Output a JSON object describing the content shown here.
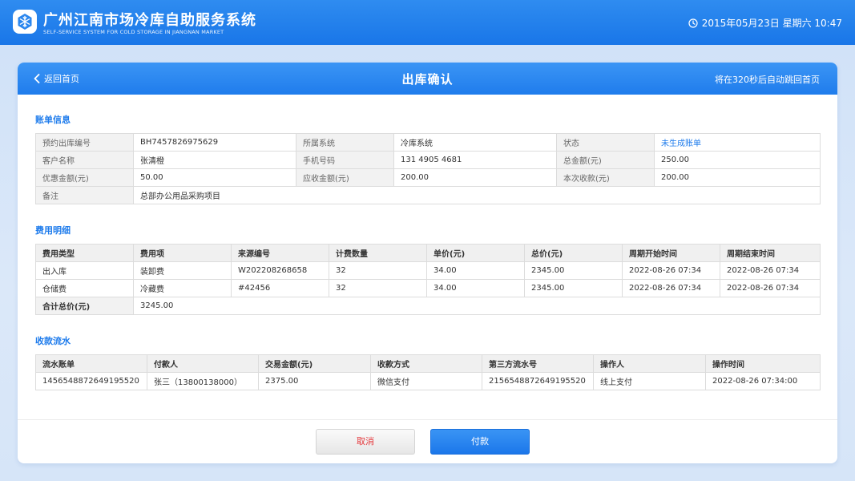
{
  "header": {
    "title": "广州江南市场冷库自助服务系统",
    "subtitle": "SELF-SERVICE SYSTEM FOR COLD STORAGE IN JIANGNAN MARKET",
    "datetime": "2015年05月23日  星期六  10:47"
  },
  "page": {
    "back_label": "返回首页",
    "title": "出库确认",
    "countdown": "将在320秒后自动跳回首页"
  },
  "bill": {
    "section_title": "账单信息",
    "rows": [
      [
        "预约出库编号",
        "BH7457826975629",
        "所属系统",
        "冷库系统",
        "状态",
        "未生成账单"
      ],
      [
        "客户名称",
        "张清橙",
        "手机号码",
        "131 4905 4681",
        "总金额(元)",
        "250.00"
      ],
      [
        "优惠金额(元)",
        "50.00",
        "应收金额(元)",
        "200.00",
        "本次收款(元)",
        "200.00"
      ],
      [
        "备注",
        "总部办公用品采购项目"
      ]
    ],
    "status_color": "#1f7cec"
  },
  "fees": {
    "section_title": "费用明细",
    "headers": [
      "费用类型",
      "费用项",
      "来源编号",
      "计费数量",
      "单价(元)",
      "总价(元)",
      "周期开始时间",
      "周期结束时间"
    ],
    "rows": [
      [
        "出入库",
        "装卸费",
        "W202208268658",
        "32",
        "34.00",
        "2345.00",
        "2022-08-26 07:34",
        "2022-08-26 07:34"
      ],
      [
        "仓储费",
        "冷藏费",
        "#42456",
        "32",
        "34.00",
        "2345.00",
        "2022-08-26 07:34",
        "2022-08-26 07:34"
      ]
    ],
    "total_label": "合计总价(元)",
    "total_value": "3245.00"
  },
  "payments": {
    "section_title": "收款流水",
    "headers": [
      "流水账单",
      "付款人",
      "交易金额(元)",
      "收款方式",
      "第三方流水号",
      "操作人",
      "操作时间"
    ],
    "rows": [
      [
        "1456548872649195520",
        "张三（13800138000）",
        "2375.00",
        "微信支付",
        "2156548872649195520",
        "线上支付",
        "2022-08-26 07:34:00"
      ]
    ]
  },
  "actions": {
    "cancel_label": "取消",
    "pay_label": "付款"
  },
  "colors": {
    "brand": "#1f7cec",
    "cancel_text": "#e5393d"
  },
  "icons": {
    "logo": "snowflake-icon",
    "clock": "clock-icon",
    "back": "chevron-left-icon"
  }
}
